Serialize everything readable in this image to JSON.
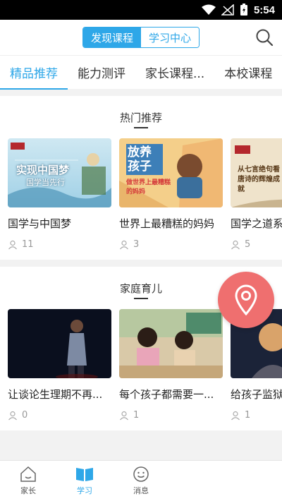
{
  "status": {
    "time": "5:54"
  },
  "header": {
    "seg_discover": "发现课程",
    "seg_study": "学习中心"
  },
  "tabs": [
    "精品推荐",
    "能力测评",
    "家长课程...",
    "本校课程"
  ],
  "sections": [
    {
      "title": "热门推荐",
      "items": [
        {
          "title": "国学与中国梦",
          "count": "11",
          "thumb_text": "实现中国梦",
          "thumb_sub": "国学当先行"
        },
        {
          "title": "世界上最糟糕的妈妈",
          "count": "3",
          "thumb_text": "放养孩子",
          "thumb_sub": "做世界上最糟糕的妈妈"
        },
        {
          "title": "国学之道系",
          "count": "5",
          "thumb_text": "从七言绝句看唐诗的辉煌成就",
          "thumb_sub": ""
        }
      ]
    },
    {
      "title": "家庭育儿",
      "items": [
        {
          "title": "让谈论生理期不再...",
          "count": "0"
        },
        {
          "title": "每个孩子都需要一...",
          "count": "1"
        },
        {
          "title": "给孩子监狱",
          "count": "1"
        }
      ]
    }
  ],
  "nav": {
    "home": "家长",
    "study": "学习",
    "messages": "消息"
  },
  "colors": {
    "accent": "#2ea7e8",
    "fab": "#ef6f6f"
  }
}
